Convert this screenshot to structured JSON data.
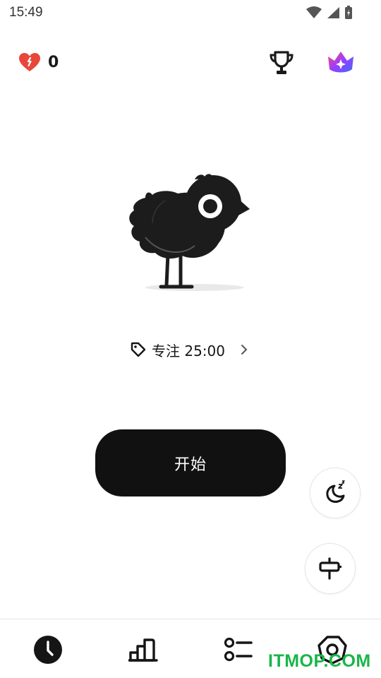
{
  "status_bar": {
    "time": "15:49"
  },
  "top": {
    "hearts_count": "0"
  },
  "focus": {
    "label": "专注 25:00"
  },
  "start": {
    "label": "开始"
  },
  "watermark": "ITMOP.COM",
  "colors": {
    "accent": "#111111",
    "heart": "#e8473a",
    "watermark": "#19b64a"
  },
  "icons": [
    "heart-icon",
    "trophy-icon",
    "crown-icon",
    "tag-icon",
    "chevron-right-icon",
    "sleep-moon-icon",
    "signpost-icon",
    "clock-icon",
    "stats-icon",
    "list-icon",
    "profile-icon"
  ]
}
